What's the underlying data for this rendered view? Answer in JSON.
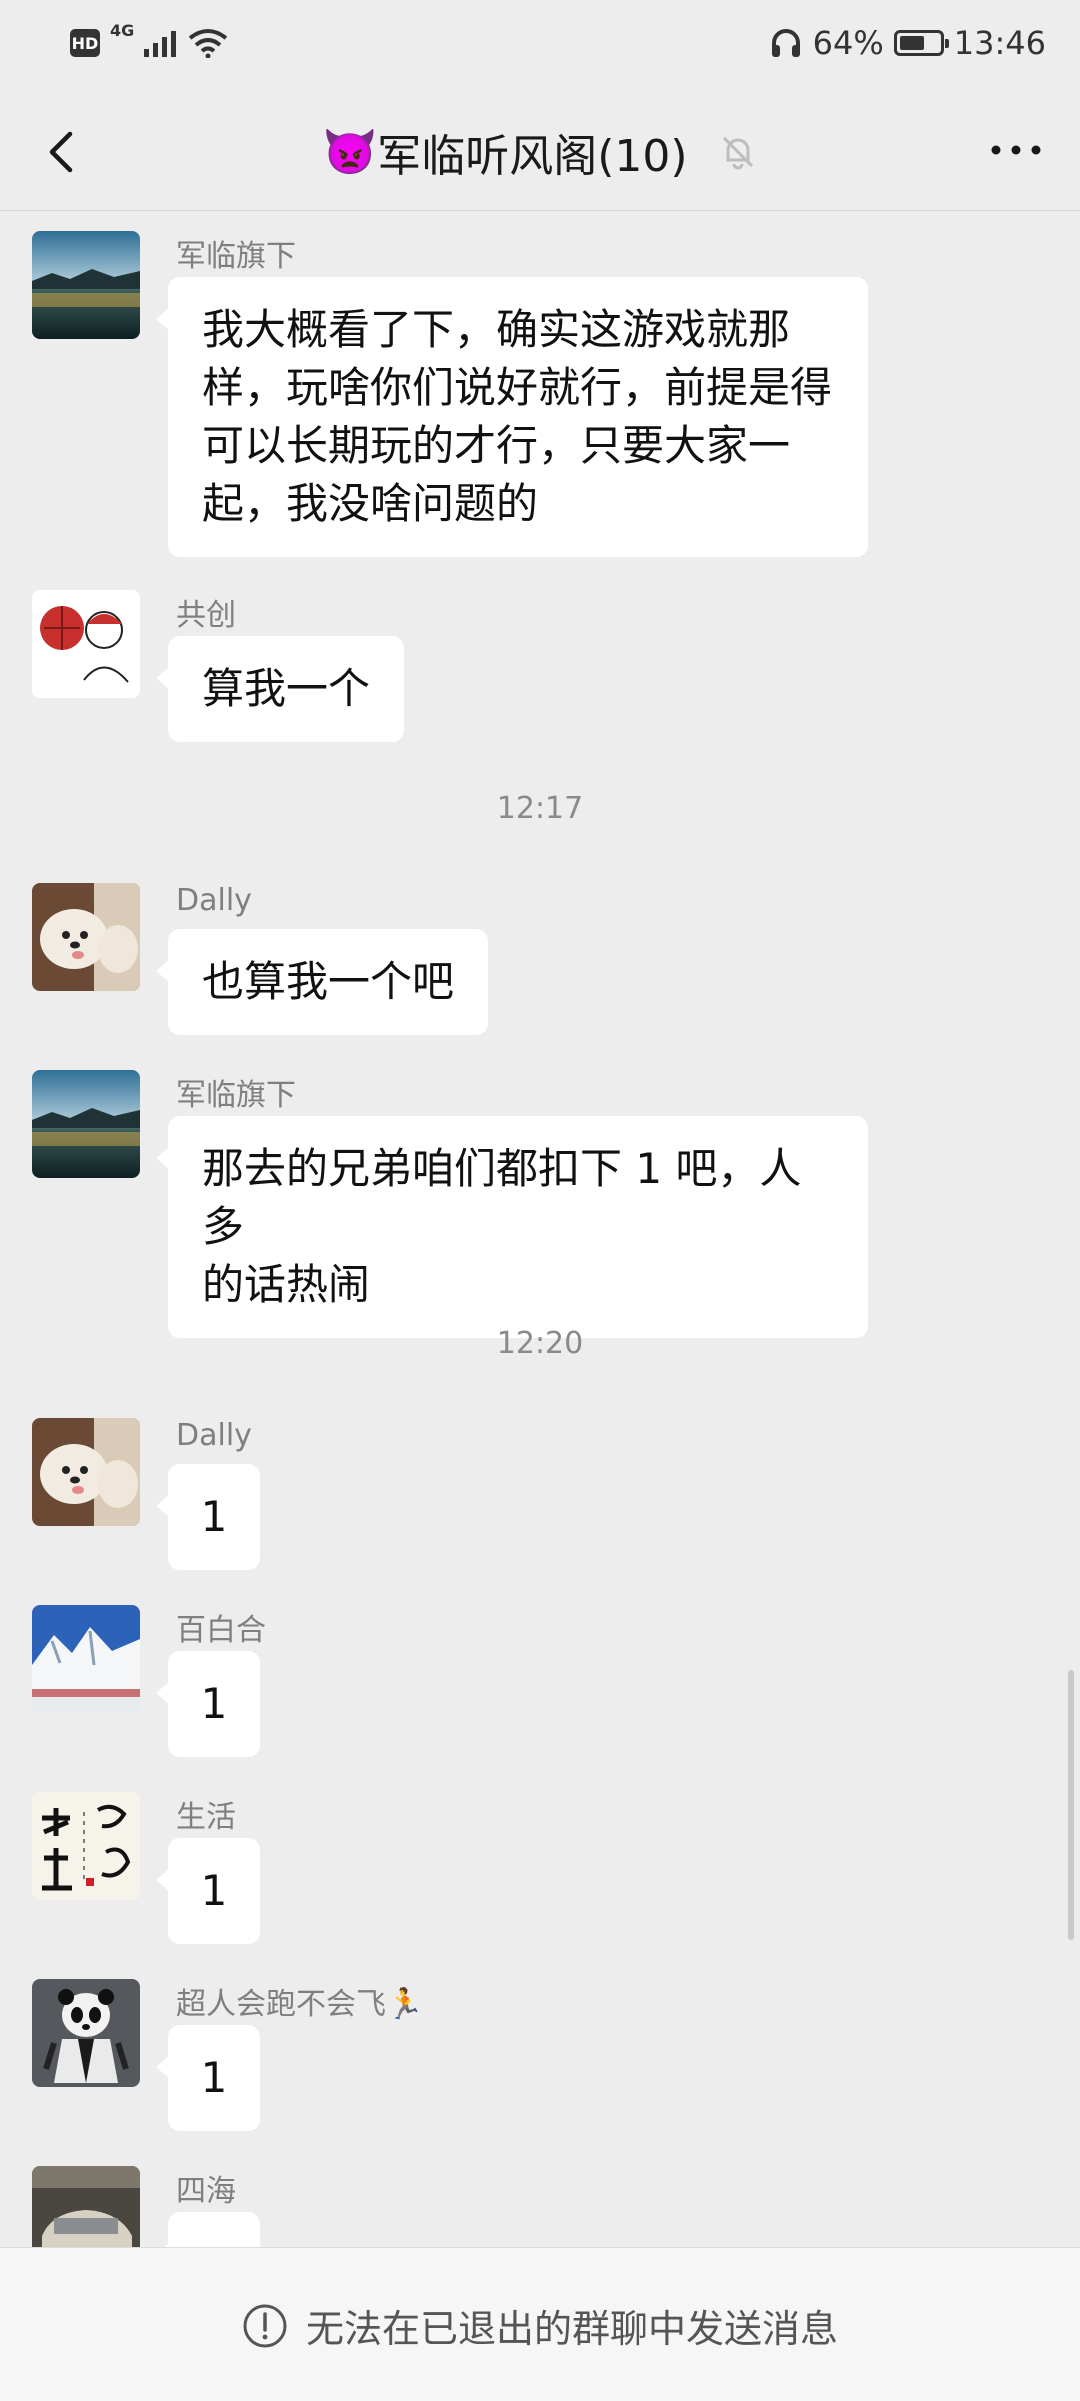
{
  "status_bar": {
    "hd": "HD",
    "network": "4G",
    "battery_percent": "64%",
    "battery_level": 0.64,
    "time": "13:46"
  },
  "header": {
    "emoji": "👿",
    "title": "军临听风阁(10)",
    "back_icon": "chevron-left-icon",
    "mute_icon": "bell-off-icon",
    "more_icon": "more-icon"
  },
  "messages": [
    {
      "sender": "军临旗下",
      "lines": [
        "我大概看了下，确实这游戏就那",
        "样，玩啥你们说好就行，前提是得",
        "可以长期玩的才行，只要大家一",
        "起，我没啥问题的"
      ]
    },
    {
      "sender": "共创",
      "lines": [
        "算我一个"
      ]
    },
    {
      "time": "12:17"
    },
    {
      "sender": "Dally",
      "lines": [
        "也算我一个吧"
      ]
    },
    {
      "sender": "军临旗下",
      "lines": [
        "那去的兄弟咱们都扣下 1 吧，人多",
        "的话热闹"
      ]
    },
    {
      "time": "12:20"
    },
    {
      "sender": "Dally",
      "lines": [
        "1"
      ]
    },
    {
      "sender": "百白合",
      "lines": [
        "1"
      ]
    },
    {
      "sender": "生活",
      "lines": [
        "1"
      ]
    },
    {
      "sender": "超人会跑不会飞🏃",
      "lines": [
        "1"
      ]
    },
    {
      "sender": "四海",
      "lines": [
        ""
      ]
    }
  ],
  "footer": {
    "notice": "无法在已退出的群聊中发送消息",
    "notice_icon": "exclamation-circle-icon"
  }
}
